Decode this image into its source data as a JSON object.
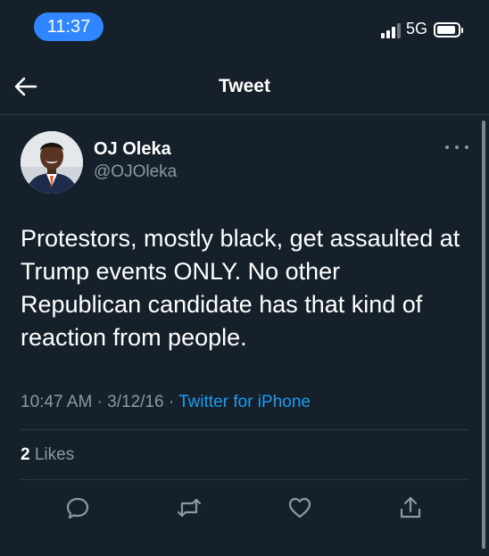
{
  "status_bar": {
    "time": "11:37",
    "network": "5G"
  },
  "header": {
    "title": "Tweet"
  },
  "tweet": {
    "author_name": "OJ Oleka",
    "author_handle": "@OJOleka",
    "text": "Protestors, mostly black, get assaulted at Trump events ONLY. No other Republican candidate has that kind of reaction from people.",
    "time": "10:47 AM",
    "separator": "·",
    "date": "3/12/16",
    "source": "Twitter for iPhone",
    "likes_count": "2",
    "likes_label": "Likes"
  },
  "icons": {
    "back": "arrow-left-icon",
    "more": "more-horizontal-icon",
    "reply": "reply-icon",
    "retweet": "retweet-icon",
    "like": "heart-icon",
    "share": "share-icon"
  },
  "colors": {
    "background": "#15202b",
    "text_primary": "#ffffff",
    "text_secondary": "#8b98a5",
    "link": "#1d9bf0",
    "time_pill": "#2f86ff",
    "divider": "#2b3946"
  }
}
